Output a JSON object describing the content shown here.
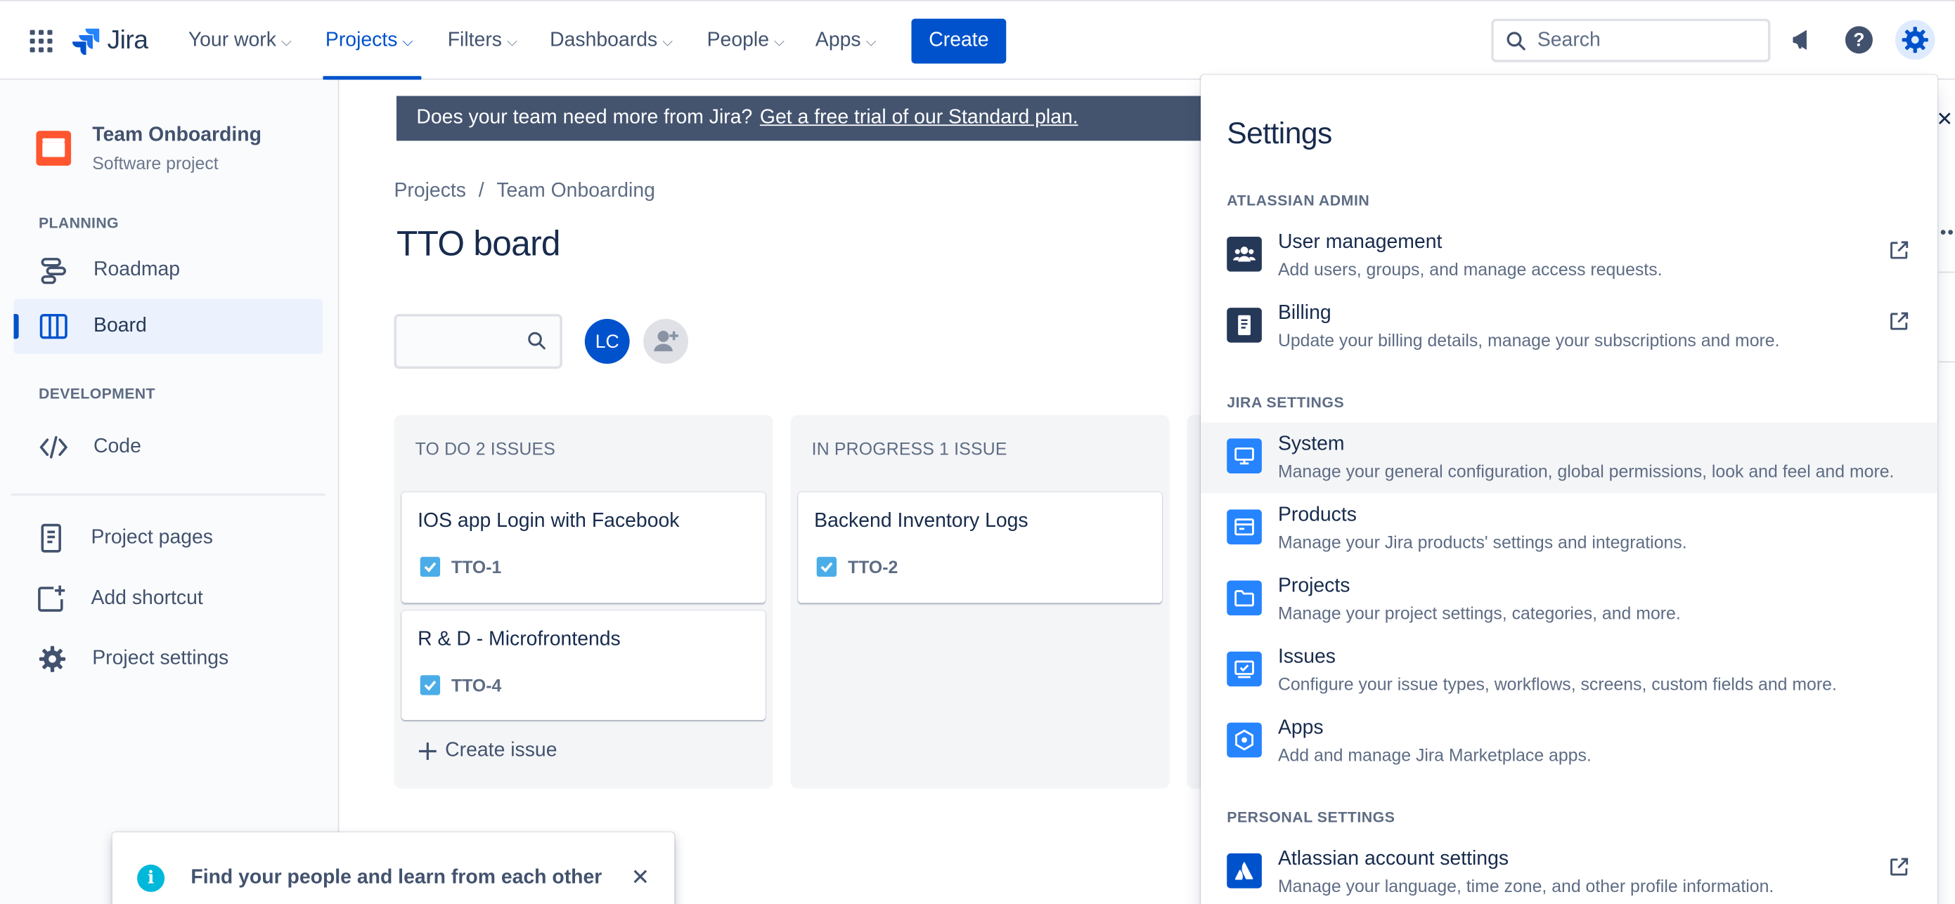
{
  "topnav": {
    "app_name": "Jira",
    "items": [
      {
        "label": "Your work"
      },
      {
        "label": "Projects"
      },
      {
        "label": "Filters"
      },
      {
        "label": "Dashboards"
      },
      {
        "label": "People"
      },
      {
        "label": "Apps"
      }
    ],
    "active_item": "Projects",
    "create_label": "Create",
    "search_placeholder": "Search",
    "accent_color": "#0052CC"
  },
  "sidebar": {
    "project_name": "Team Onboarding",
    "project_type": "Software project",
    "planning_label": "PLANNING",
    "development_label": "DEVELOPMENT",
    "items": [
      {
        "label": "Roadmap",
        "icon": "roadmap-icon"
      },
      {
        "label": "Board",
        "icon": "board-icon",
        "selected": true
      },
      {
        "label": "Code",
        "icon": "code-icon"
      },
      {
        "label": "Project pages",
        "icon": "page-icon"
      },
      {
        "label": "Add shortcut",
        "icon": "add-shortcut-icon"
      },
      {
        "label": "Project settings",
        "icon": "gear-icon"
      }
    ]
  },
  "banner": {
    "text": "Does your team need more from Jira?",
    "link": "Get a free trial of our Standard plan."
  },
  "breadcrumb": {
    "root": "Projects",
    "separator": "/",
    "current": "Team Onboarding"
  },
  "board": {
    "title": "TTO board",
    "avatar_initials": "LC",
    "columns": [
      {
        "header": "TO DO 2 ISSUES",
        "cards": [
          {
            "title": "IOS app Login with Facebook",
            "key": "TTO-1"
          },
          {
            "title": "R & D - Microfrontends",
            "key": "TTO-4"
          }
        ],
        "create_label": "Create issue"
      },
      {
        "header": "IN PROGRESS 1 ISSUE",
        "cards": [
          {
            "title": "Backend Inventory Logs",
            "key": "TTO-2"
          }
        ]
      }
    ]
  },
  "toast": {
    "message": "Find your people and learn from each other"
  },
  "settings_panel": {
    "title": "Settings",
    "sections": [
      {
        "label": "ATLASSIAN ADMIN",
        "items": [
          {
            "title": "User management",
            "description": "Add users, groups, and manage access requests.",
            "icon": "users-icon",
            "external": true
          },
          {
            "title": "Billing",
            "description": "Update your billing details, manage your subscriptions and more.",
            "icon": "billing-icon",
            "external": true
          }
        ]
      },
      {
        "label": "JIRA SETTINGS",
        "items": [
          {
            "title": "System",
            "description": "Manage your general configuration, global permissions, look and feel and more.",
            "icon": "monitor-icon",
            "hover": true
          },
          {
            "title": "Products",
            "description": "Manage your Jira products' settings and integrations.",
            "icon": "products-icon"
          },
          {
            "title": "Projects",
            "description": "Manage your project settings, categories, and more.",
            "icon": "folder-icon"
          },
          {
            "title": "Issues",
            "description": "Configure your issue types, workflows, screens, custom fields and more.",
            "icon": "issues-icon"
          },
          {
            "title": "Apps",
            "description": "Add and manage Jira Marketplace apps.",
            "icon": "apps-icon"
          }
        ]
      },
      {
        "label": "PERSONAL SETTINGS",
        "items": [
          {
            "title": "Atlassian account settings",
            "description": "Manage your language, time zone, and other profile information.",
            "icon": "atlassian-icon",
            "external": true
          }
        ]
      }
    ]
  }
}
